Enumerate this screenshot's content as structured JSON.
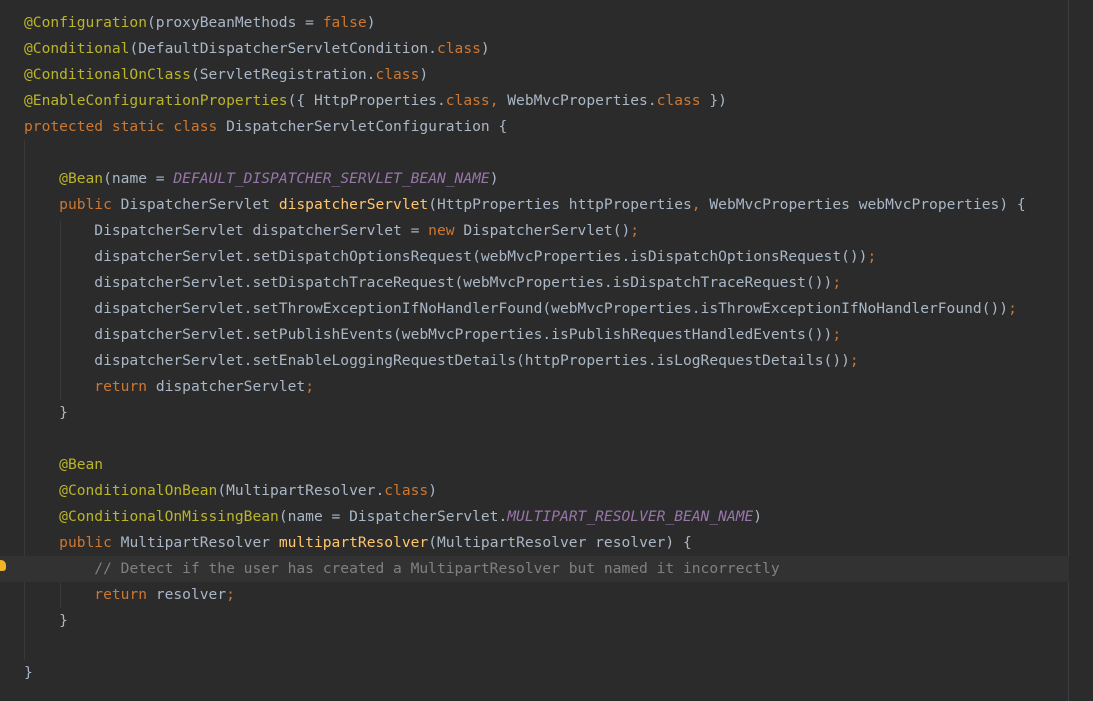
{
  "editor": {
    "lines": [
      {
        "cls": "",
        "tokens": [
          {
            "t": "@Configuration",
            "c": "ann"
          },
          {
            "t": "(proxyBeanMethods = ",
            "c": "txt"
          },
          {
            "t": "false",
            "c": "kw"
          },
          {
            "t": ")",
            "c": "txt"
          }
        ]
      },
      {
        "cls": "",
        "tokens": [
          {
            "t": "@Conditional",
            "c": "ann"
          },
          {
            "t": "(DefaultDispatcherServletCondition.",
            "c": "txt"
          },
          {
            "t": "class",
            "c": "kw"
          },
          {
            "t": ")",
            "c": "txt"
          }
        ]
      },
      {
        "cls": "",
        "tokens": [
          {
            "t": "@ConditionalOnClass",
            "c": "ann"
          },
          {
            "t": "(ServletRegistration.",
            "c": "txt"
          },
          {
            "t": "class",
            "c": "kw"
          },
          {
            "t": ")",
            "c": "txt"
          }
        ]
      },
      {
        "cls": "",
        "tokens": [
          {
            "t": "@EnableConfigurationProperties",
            "c": "ann"
          },
          {
            "t": "({ HttpProperties.",
            "c": "txt"
          },
          {
            "t": "class",
            "c": "kw"
          },
          {
            "t": ", ",
            "c": "kw"
          },
          {
            "t": "WebMvcProperties.",
            "c": "txt"
          },
          {
            "t": "class",
            "c": "kw"
          },
          {
            "t": " })",
            "c": "txt"
          }
        ]
      },
      {
        "cls": "",
        "tokens": [
          {
            "t": "protected static class ",
            "c": "kw"
          },
          {
            "t": "DispatcherServletConfiguration {",
            "c": "txt"
          }
        ]
      },
      {
        "cls": "",
        "tokens": []
      },
      {
        "cls": "",
        "tokens": [
          {
            "t": "    ",
            "c": "txt"
          },
          {
            "t": "@Bean",
            "c": "ann"
          },
          {
            "t": "(name = ",
            "c": "txt"
          },
          {
            "t": "DEFAULT_DISPATCHER_SERVLET_BEAN_NAME",
            "c": "const"
          },
          {
            "t": ")",
            "c": "txt"
          }
        ]
      },
      {
        "cls": "",
        "tokens": [
          {
            "t": "    ",
            "c": "txt"
          },
          {
            "t": "public ",
            "c": "kw"
          },
          {
            "t": "DispatcherServlet ",
            "c": "txt"
          },
          {
            "t": "dispatcherServlet",
            "c": "fn"
          },
          {
            "t": "(HttpProperties httpProperties",
            "c": "txt"
          },
          {
            "t": ", ",
            "c": "kw"
          },
          {
            "t": "WebMvcProperties webMvcProperties) {",
            "c": "txt"
          }
        ]
      },
      {
        "cls": "",
        "tokens": [
          {
            "t": "        DispatcherServlet dispatcherServlet = ",
            "c": "txt"
          },
          {
            "t": "new ",
            "c": "kw"
          },
          {
            "t": "DispatcherServlet()",
            "c": "txt"
          },
          {
            "t": ";",
            "c": "kw"
          }
        ]
      },
      {
        "cls": "",
        "tokens": [
          {
            "t": "        dispatcherServlet.setDispatchOptionsRequest(webMvcProperties.isDispatchOptionsRequest())",
            "c": "txt"
          },
          {
            "t": ";",
            "c": "kw"
          }
        ]
      },
      {
        "cls": "",
        "tokens": [
          {
            "t": "        dispatcherServlet.setDispatchTraceRequest(webMvcProperties.isDispatchTraceRequest())",
            "c": "txt"
          },
          {
            "t": ";",
            "c": "kw"
          }
        ]
      },
      {
        "cls": "",
        "tokens": [
          {
            "t": "        dispatcherServlet.setThrowExceptionIfNoHandlerFound(webMvcProperties.isThrowExceptionIfNoHandlerFound())",
            "c": "txt"
          },
          {
            "t": ";",
            "c": "kw"
          }
        ]
      },
      {
        "cls": "",
        "tokens": [
          {
            "t": "        dispatcherServlet.setPublishEvents(webMvcProperties.isPublishRequestHandledEvents())",
            "c": "txt"
          },
          {
            "t": ";",
            "c": "kw"
          }
        ]
      },
      {
        "cls": "",
        "tokens": [
          {
            "t": "        dispatcherServlet.setEnableLoggingRequestDetails(httpProperties.isLogRequestDetails())",
            "c": "txt"
          },
          {
            "t": ";",
            "c": "kw"
          }
        ]
      },
      {
        "cls": "",
        "tokens": [
          {
            "t": "        ",
            "c": "txt"
          },
          {
            "t": "return ",
            "c": "kw"
          },
          {
            "t": "dispatcherServlet",
            "c": "txt"
          },
          {
            "t": ";",
            "c": "kw"
          }
        ]
      },
      {
        "cls": "",
        "tokens": [
          {
            "t": "    }",
            "c": "txt"
          }
        ]
      },
      {
        "cls": "",
        "tokens": []
      },
      {
        "cls": "",
        "tokens": [
          {
            "t": "    ",
            "c": "txt"
          },
          {
            "t": "@Bean",
            "c": "ann"
          }
        ]
      },
      {
        "cls": "",
        "tokens": [
          {
            "t": "    ",
            "c": "txt"
          },
          {
            "t": "@ConditionalOnBean",
            "c": "ann"
          },
          {
            "t": "(MultipartResolver.",
            "c": "txt"
          },
          {
            "t": "class",
            "c": "kw"
          },
          {
            "t": ")",
            "c": "txt"
          }
        ]
      },
      {
        "cls": "",
        "tokens": [
          {
            "t": "    ",
            "c": "txt"
          },
          {
            "t": "@ConditionalOnMissingBean",
            "c": "ann"
          },
          {
            "t": "(name = DispatcherServlet.",
            "c": "txt"
          },
          {
            "t": "MULTIPART_RESOLVER_BEAN_NAME",
            "c": "const"
          },
          {
            "t": ")",
            "c": "txt"
          }
        ]
      },
      {
        "cls": "",
        "tokens": [
          {
            "t": "    ",
            "c": "txt"
          },
          {
            "t": "public ",
            "c": "kw"
          },
          {
            "t": "MultipartResolver ",
            "c": "txt"
          },
          {
            "t": "multipartResolver",
            "c": "fn"
          },
          {
            "t": "(MultipartResolver resolver) {",
            "c": "txt"
          }
        ]
      },
      {
        "cls": "current",
        "tokens": [
          {
            "t": "        ",
            "c": "txt"
          },
          {
            "t": "// Detect if the user has created a MultipartResolver but named it incorrectly",
            "c": "com"
          }
        ]
      },
      {
        "cls": "",
        "tokens": [
          {
            "t": "        ",
            "c": "txt"
          },
          {
            "t": "return ",
            "c": "kw"
          },
          {
            "t": "resolver",
            "c": "txt"
          },
          {
            "t": ";",
            "c": "kw"
          }
        ]
      },
      {
        "cls": "",
        "tokens": [
          {
            "t": "    }",
            "c": "txt"
          }
        ]
      },
      {
        "cls": "",
        "tokens": []
      },
      {
        "cls": "",
        "tokens": [
          {
            "t": "}",
            "c": "txt"
          }
        ]
      }
    ]
  },
  "gutter": {
    "intention_icon": "lightbulb-icon"
  },
  "colors": {
    "background": "#2b2b2b",
    "text": "#a9b7c6",
    "annotation": "#bbb529",
    "keyword": "#cc7832",
    "method": "#ffc66d",
    "constant": "#9876aa",
    "comment": "#808080",
    "caret_line": "#323232",
    "intention_bulb": "#f0b42a"
  }
}
